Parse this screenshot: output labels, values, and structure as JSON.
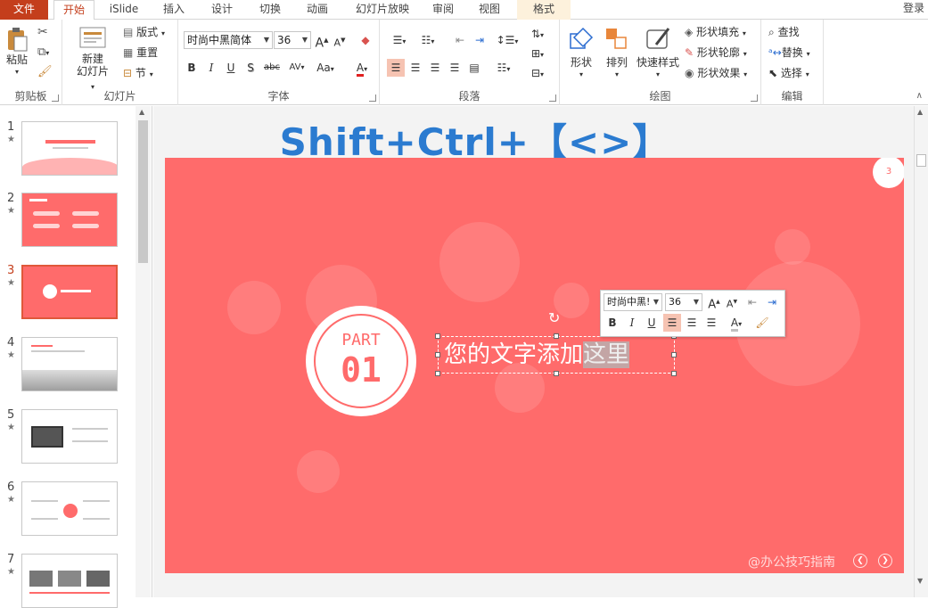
{
  "tabs": [
    {
      "label": "文件"
    },
    {
      "label": "开始"
    },
    {
      "label": "iSlide"
    },
    {
      "label": "插入"
    },
    {
      "label": "设计"
    },
    {
      "label": "切换"
    },
    {
      "label": "动画"
    },
    {
      "label": "幻灯片放映"
    },
    {
      "label": "审阅"
    },
    {
      "label": "视图"
    },
    {
      "label": "格式"
    }
  ],
  "login": "登录",
  "clipboard": {
    "paste": "粘贴",
    "group": "剪贴板"
  },
  "slides_group": {
    "new": "新建",
    "new2": "幻灯片",
    "layout": "版式",
    "reset": "重置",
    "section": "节",
    "group": "幻灯片"
  },
  "font": {
    "name": "时尚中黑简体",
    "size": "36",
    "group": "字体",
    "bold": "B",
    "italic": "I",
    "underline": "U",
    "shadow": "S",
    "strike": "abc",
    "spacing": "AV",
    "case": "Aa",
    "color": "A",
    "grow": "A",
    "shrink": "A"
  },
  "paragraph": {
    "group": "段落"
  },
  "drawing": {
    "shape": "形状",
    "arrange": "排列",
    "quick_style": "快速样式",
    "fill": "形状填充",
    "outline": "形状轮廓",
    "effect": "形状效果",
    "group": "绘图"
  },
  "editing": {
    "find": "查找",
    "replace": "替换",
    "select": "选择",
    "group": "编辑"
  },
  "thumbs": [
    {
      "num": "1",
      "star": "★"
    },
    {
      "num": "2",
      "star": "★"
    },
    {
      "num": "3",
      "star": "★"
    },
    {
      "num": "4",
      "star": "★"
    },
    {
      "num": "5",
      "star": "★"
    },
    {
      "num": "6",
      "star": "★"
    },
    {
      "num": "7",
      "star": "★"
    }
  ],
  "heading": "Shift+Ctrl+【<>】",
  "slide": {
    "page": "3",
    "part": "PART",
    "num": "01",
    "text_a": "您的文字添加",
    "text_b": "这里",
    "watermark": "@办公技巧指南",
    "accent": "#ff6b6b"
  },
  "mini_toolbar": {
    "font": "时尚中黑!",
    "size": "36",
    "bold": "B",
    "italic": "I",
    "underline": "U",
    "color": "A"
  }
}
